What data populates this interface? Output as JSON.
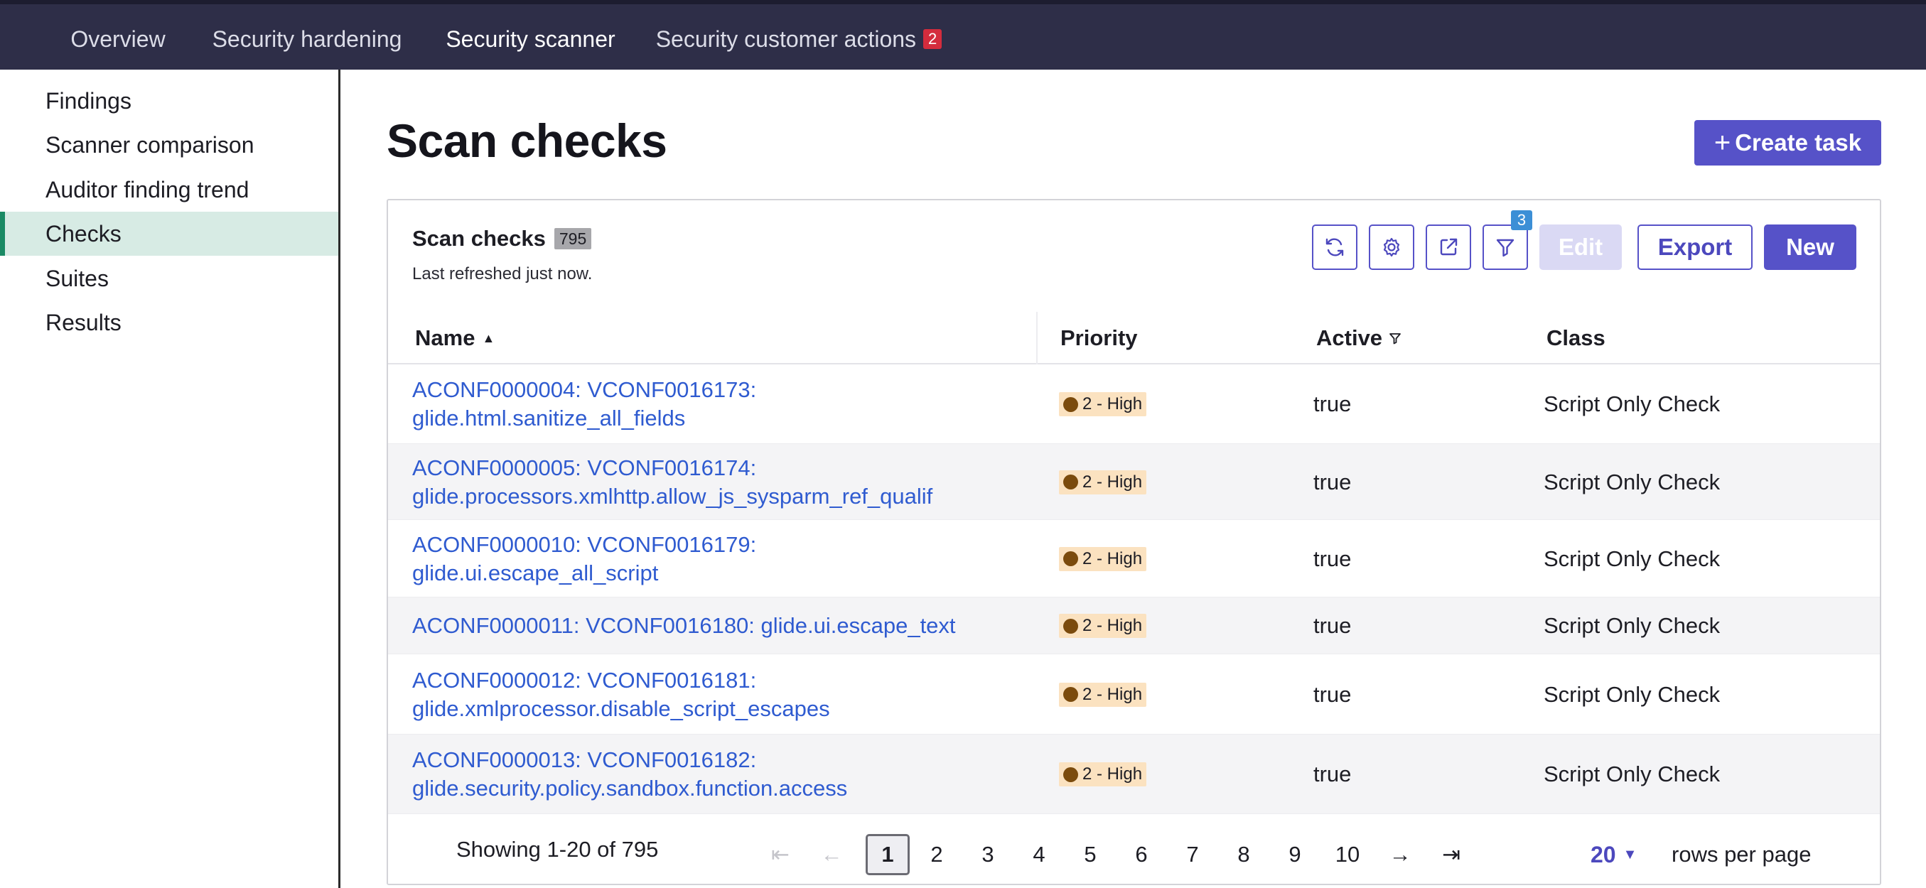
{
  "topnav": {
    "tabs": [
      {
        "label": "Overview"
      },
      {
        "label": "Security hardening"
      },
      {
        "label": "Security scanner",
        "active": true
      },
      {
        "label": "Security customer actions",
        "badge": "2"
      }
    ]
  },
  "sidebar": {
    "items": [
      {
        "label": "Findings"
      },
      {
        "label": "Scanner comparison"
      },
      {
        "label": "Auditor finding trend"
      },
      {
        "label": "Checks",
        "active": true
      },
      {
        "label": "Suites"
      },
      {
        "label": "Results"
      }
    ]
  },
  "page": {
    "title": "Scan checks",
    "create_label": "Create task"
  },
  "panel": {
    "title": "Scan checks",
    "count": "795",
    "refreshed": "Last refreshed just now.",
    "filter_count": "3",
    "edit_label": "Edit",
    "export_label": "Export",
    "new_label": "New",
    "icons": [
      "refresh-icon",
      "gear-icon",
      "share-icon",
      "filter-icon"
    ]
  },
  "table": {
    "columns": {
      "name": "Name",
      "priority": "Priority",
      "active": "Active",
      "class": "Class"
    },
    "sort": {
      "column": "name",
      "direction": "ascending"
    },
    "rows": [
      {
        "name_line1": "ACONF0000004: VCONF0016173:",
        "name_line2": "glide.html.sanitize_all_fields",
        "priority": "2 - High",
        "active": "true",
        "class": "Script Only Check"
      },
      {
        "name_line1": "ACONF0000005: VCONF0016174:",
        "name_line2": "glide.processors.xmlhttp.allow_js_sysparm_ref_qualif",
        "priority": "2 - High",
        "active": "true",
        "class": "Script Only Check"
      },
      {
        "name_line1": "ACONF0000010: VCONF0016179:",
        "name_line2": "glide.ui.escape_all_script",
        "priority": "2 - High",
        "active": "true",
        "class": "Script Only Check"
      },
      {
        "name_line1": "ACONF0000011: VCONF0016180: glide.ui.escape_text",
        "name_line2": "",
        "priority": "2 - High",
        "active": "true",
        "class": "Script Only Check"
      },
      {
        "name_line1": "ACONF0000012: VCONF0016181:",
        "name_line2": "glide.xmlprocessor.disable_script_escapes",
        "priority": "2 - High",
        "active": "true",
        "class": "Script Only Check"
      },
      {
        "name_line1": "ACONF0000013: VCONF0016182:",
        "name_line2": "glide.security.policy.sandbox.function.access",
        "priority": "2 - High",
        "active": "true",
        "class": "Script Only Check"
      }
    ]
  },
  "pagination": {
    "showing": "Showing 1-20 of 795",
    "current_page": "1",
    "pages": [
      "1",
      "2",
      "3",
      "4",
      "5",
      "6",
      "7",
      "8",
      "9",
      "10"
    ],
    "first_icon": "⇤",
    "prev_icon": "←",
    "next_icon": "→",
    "last_icon": "⇥",
    "rows_per_page": "20",
    "rows_label": "rows per page"
  },
  "colors": {
    "nav_bg": "#2e2e48",
    "accent": "#5652c8",
    "link": "#2f5bd0",
    "sidebar_active": "#d7ebe4",
    "sidebar_active_border": "#1a8a64",
    "priority_bg": "#fbe2c0",
    "priority_dot": "#7b4b0d",
    "badge_red": "#d42c3d",
    "filter_badge": "#3c8fd6"
  }
}
